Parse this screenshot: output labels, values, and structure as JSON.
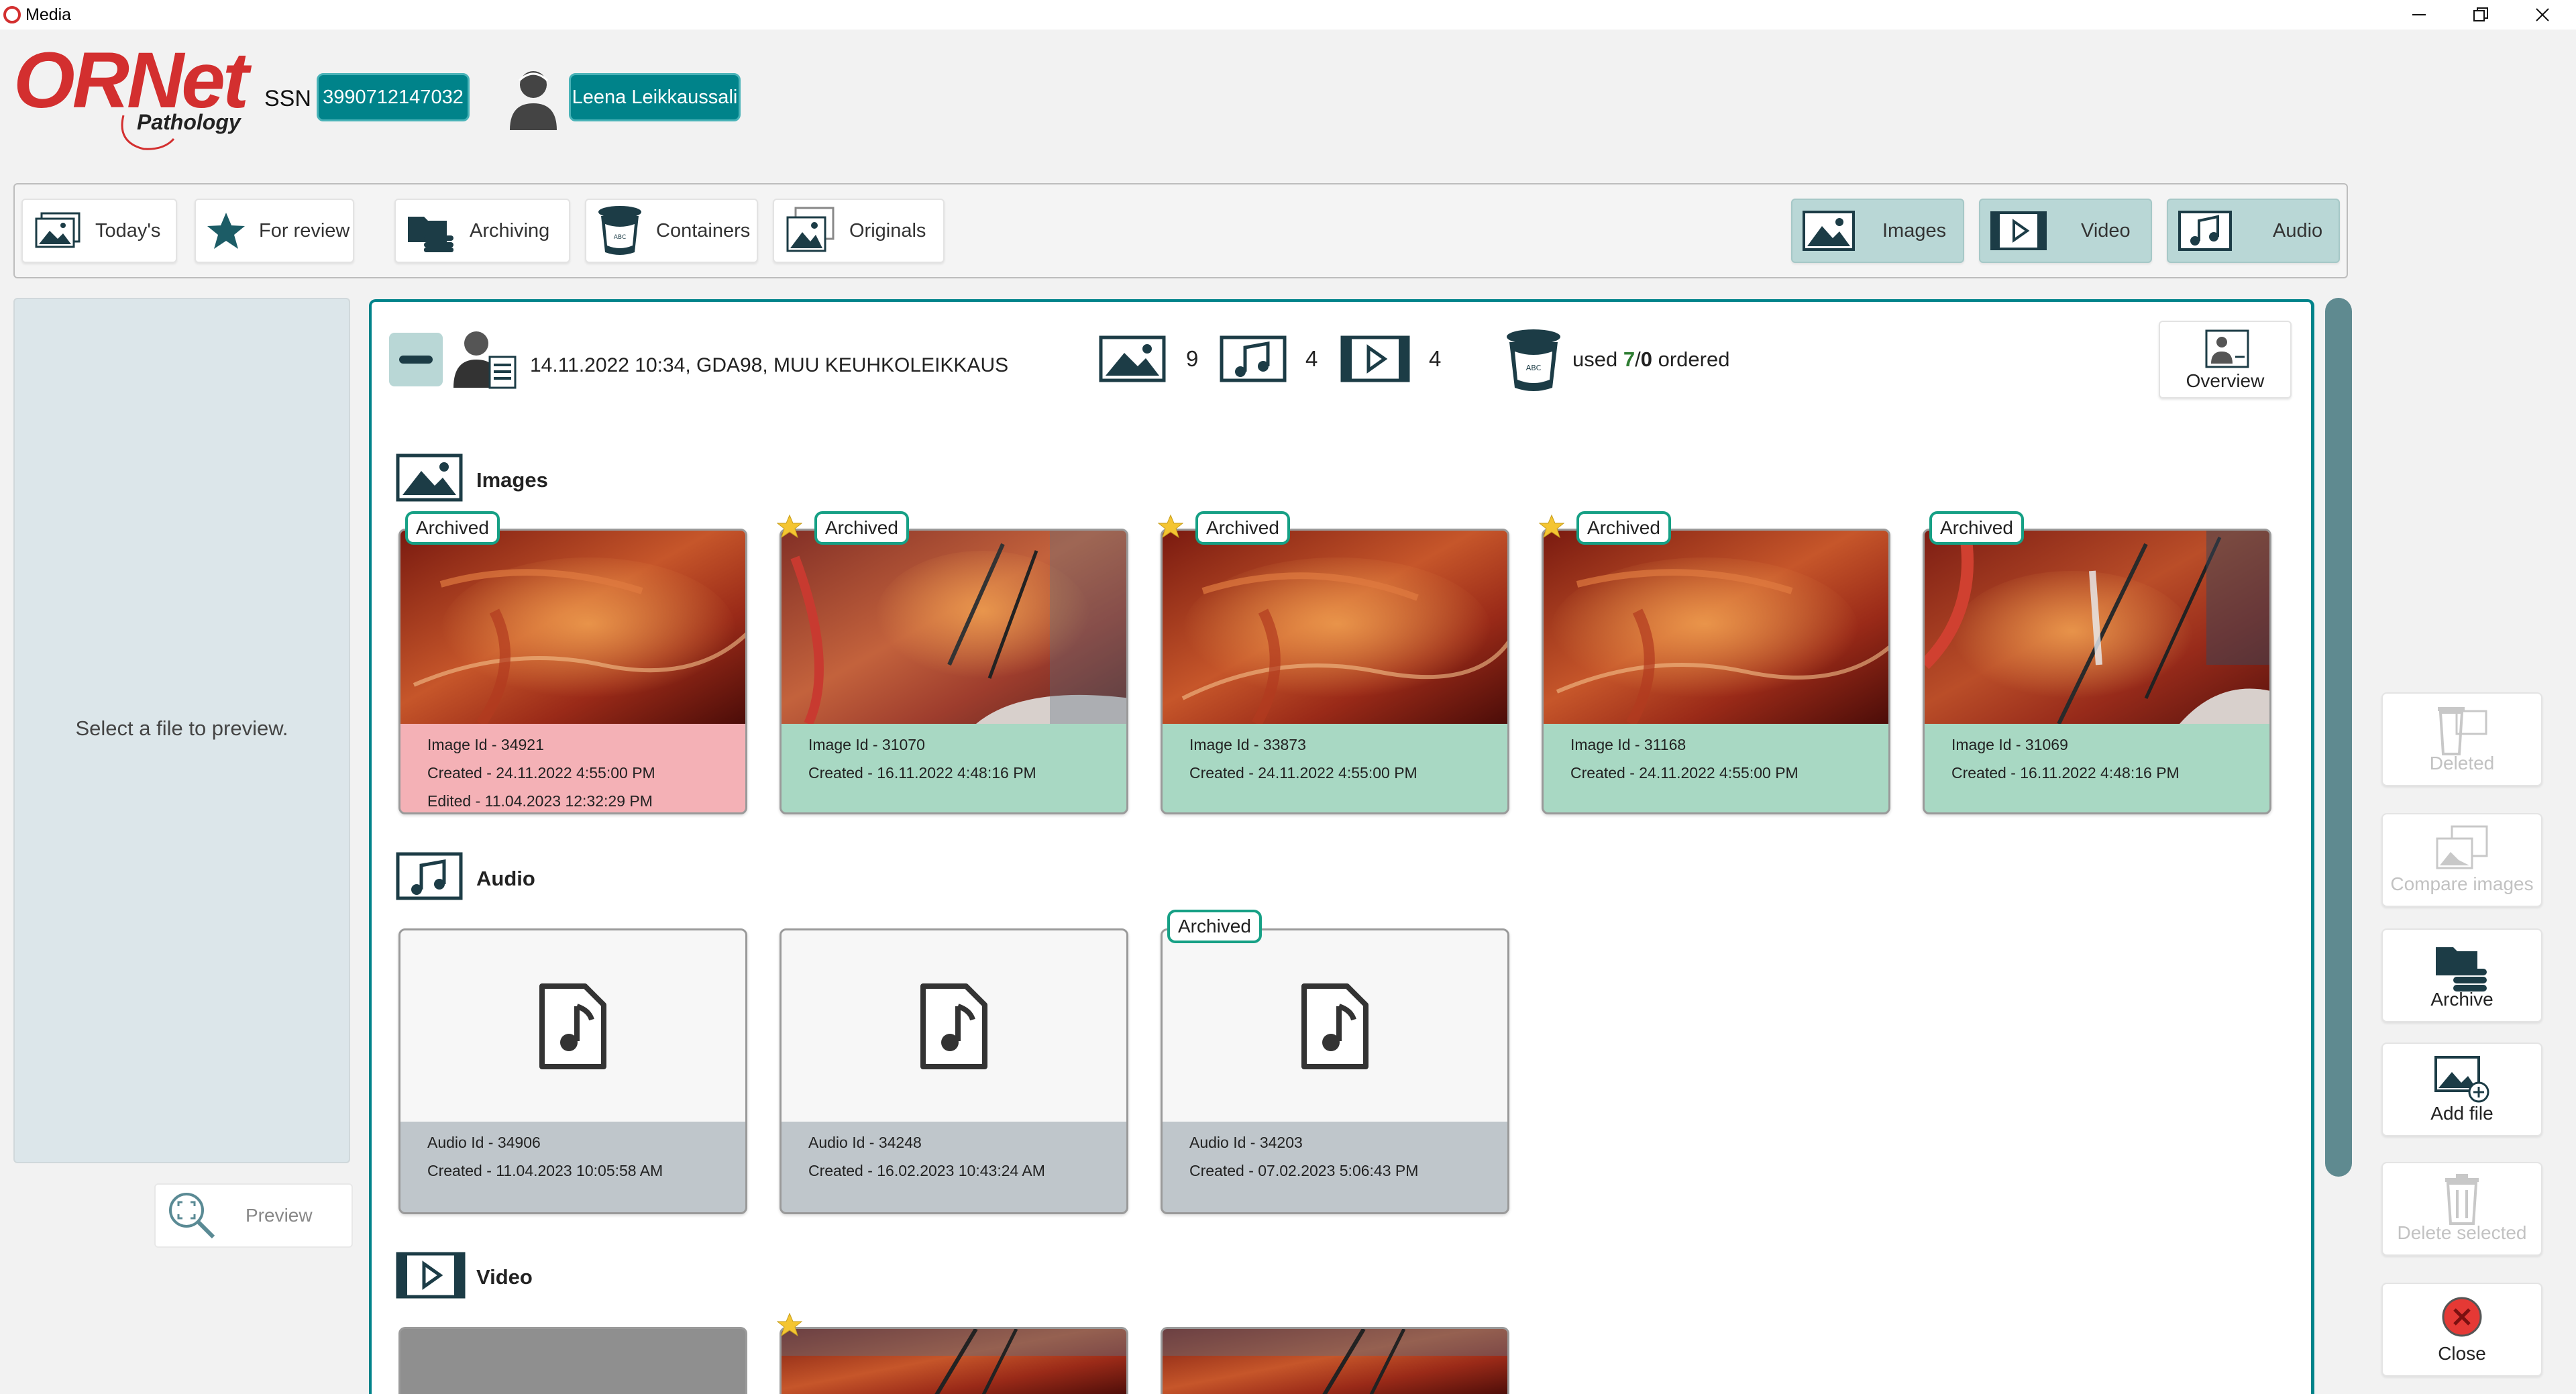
{
  "window": {
    "title": "Media"
  },
  "header": {
    "logo_main": "ORNet",
    "logo_sub": "Pathology",
    "ssn_label": "SSN",
    "ssn_value": "3990712147032",
    "user_name": "Leena Leikkaussali"
  },
  "toolbar": {
    "left": [
      {
        "label": "Today's",
        "icon": "images-stack-icon"
      },
      {
        "label": "For review",
        "icon": "star-icon"
      },
      {
        "label": "Archiving",
        "icon": "archive-folder-icon"
      },
      {
        "label": "Containers",
        "icon": "container-jar-icon"
      },
      {
        "label": "Originals",
        "icon": "originals-icon"
      }
    ],
    "right": [
      {
        "label": "Images",
        "icon": "image-icon",
        "active": true
      },
      {
        "label": "Video",
        "icon": "video-icon",
        "active": true
      },
      {
        "label": "Audio",
        "icon": "audio-icon",
        "active": true
      }
    ]
  },
  "preview": {
    "hint": "Select a file to preview.",
    "button_label": "Preview"
  },
  "case": {
    "text": "14.11.2022 10:34, GDA98, MUU KEUHKOLEIKKAUS",
    "image_count": "9",
    "audio_count": "4",
    "video_count": "4",
    "used_prefix": "used",
    "used": "7",
    "separator": "/",
    "ordered": "0",
    "ordered_suffix": "ordered",
    "overview_label": "Overview"
  },
  "sections": {
    "images": "Images",
    "audio": "Audio",
    "video": "Video"
  },
  "images": [
    {
      "badge": "Archived",
      "starred": false,
      "status": "edited",
      "lines": [
        "Image Id - 34921",
        "Created - 24.11.2022 4:55:00 PM",
        "Edited - 11.04.2023 12:32:29 PM"
      ]
    },
    {
      "badge": "Archived",
      "starred": true,
      "status": "archived",
      "lines": [
        "Image Id - 31070",
        "Created - 16.11.2022 4:48:16 PM"
      ]
    },
    {
      "badge": "Archived",
      "starred": true,
      "status": "archived",
      "lines": [
        "Image Id - 33873",
        "Created - 24.11.2022 4:55:00 PM"
      ]
    },
    {
      "badge": "Archived",
      "starred": true,
      "status": "archived",
      "lines": [
        "Image Id - 31168",
        "Created - 24.11.2022 4:55:00 PM"
      ]
    },
    {
      "badge": "Archived",
      "starred": false,
      "status": "archived",
      "lines": [
        "Image Id - 31069",
        "Created - 16.11.2022 4:48:16 PM"
      ]
    }
  ],
  "audio": [
    {
      "badge": "",
      "lines": [
        "Audio Id - 34906",
        "Created - 11.04.2023 10:05:58 AM"
      ]
    },
    {
      "badge": "",
      "lines": [
        "Audio Id - 34248",
        "Created - 16.02.2023 10:43:24 AM"
      ]
    },
    {
      "badge": "Archived",
      "lines": [
        "Audio Id - 34203",
        "Created - 07.02.2023 5:06:43 PM"
      ]
    }
  ],
  "actions": [
    {
      "label": "Deleted",
      "enabled": false,
      "icon": "trash-images-icon"
    },
    {
      "label": "Compare images",
      "enabled": false,
      "icon": "compare-images-icon"
    },
    {
      "label": "Archive",
      "enabled": true,
      "icon": "archive-icon"
    },
    {
      "label": "Add file",
      "enabled": true,
      "icon": "add-file-icon"
    },
    {
      "label": "Delete selected",
      "enabled": false,
      "icon": "trash-icon"
    },
    {
      "label": "Close",
      "enabled": true,
      "icon": "close-circle-icon"
    }
  ],
  "colors": {
    "accent": "#00838a",
    "archived_card": "#a8d8c3",
    "edited_card": "#f4b1b6",
    "audio_card": "#bfc6cb",
    "badge_border": "#16a085"
  }
}
